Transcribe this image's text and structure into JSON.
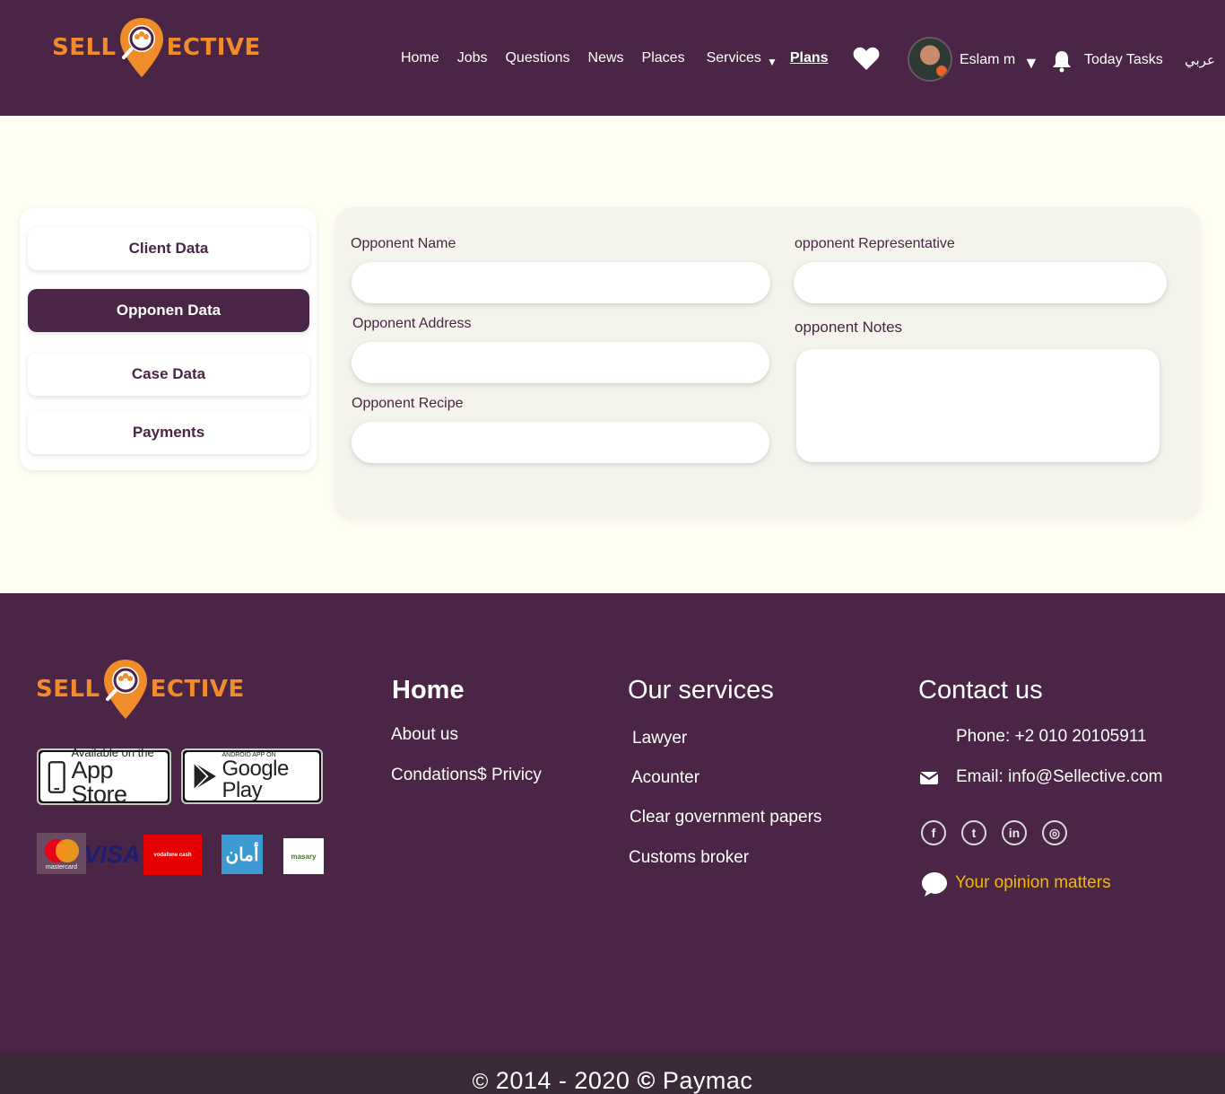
{
  "brand": {
    "left": "SELL",
    "right": "ECTIVE",
    "orange": "#f08c2a",
    "purple": "#4a2545"
  },
  "nav": {
    "items": [
      "Home",
      "Jobs",
      "Questions",
      "News",
      "Places"
    ],
    "services": "Services",
    "plans": "Plans",
    "user_name": "Eslam m",
    "today_tasks": "Today Tasks",
    "language": "عربي",
    "icons": [
      "heart-icon",
      "chevron-down-icon",
      "bell-icon"
    ]
  },
  "sidebar": {
    "items": [
      "Client Data",
      "Opponen Data",
      "Case Data",
      "Payments"
    ],
    "active_index": 1
  },
  "form": {
    "opponent_name_label": "Opponent Name",
    "opponent_name_value": "",
    "opponent_representative_label": "opponent Representative",
    "opponent_representative_value": "",
    "opponent_address_label": "Opponent Address",
    "opponent_address_value": "",
    "opponent_notes_label": "opponent Notes",
    "opponent_notes_value": "",
    "opponent_recipe_label": "Opponent Recipe",
    "opponent_recipe_value": ""
  },
  "footer": {
    "app_store": {
      "small": "Available on the",
      "big": "App Store"
    },
    "google_play": {
      "small": "ANDROID APP ON",
      "big": "Google Play"
    },
    "payments": [
      "mastercard",
      "VISA",
      "vodafone cash",
      "أمان",
      "masary"
    ],
    "home_heading": "Home",
    "home_links": [
      "About us",
      "Condations$ Privicy"
    ],
    "services_heading": "Our services",
    "services_links": [
      "Lawyer",
      "Acounter",
      "Clear government papers",
      "Customs broker"
    ],
    "contact_heading": "Contact us",
    "phone": "Phone: +2 010 20105911",
    "email": "Email: info@Sellective.com",
    "social_icons": [
      "facebook-icon",
      "twitter-icon",
      "linkedin-icon",
      "dribbble-icon"
    ],
    "opinion": "Your opinion matters",
    "opinion_color": "#f5b700"
  },
  "copyright": {
    "years": "2014 - 2020",
    "company": "Paymac"
  }
}
